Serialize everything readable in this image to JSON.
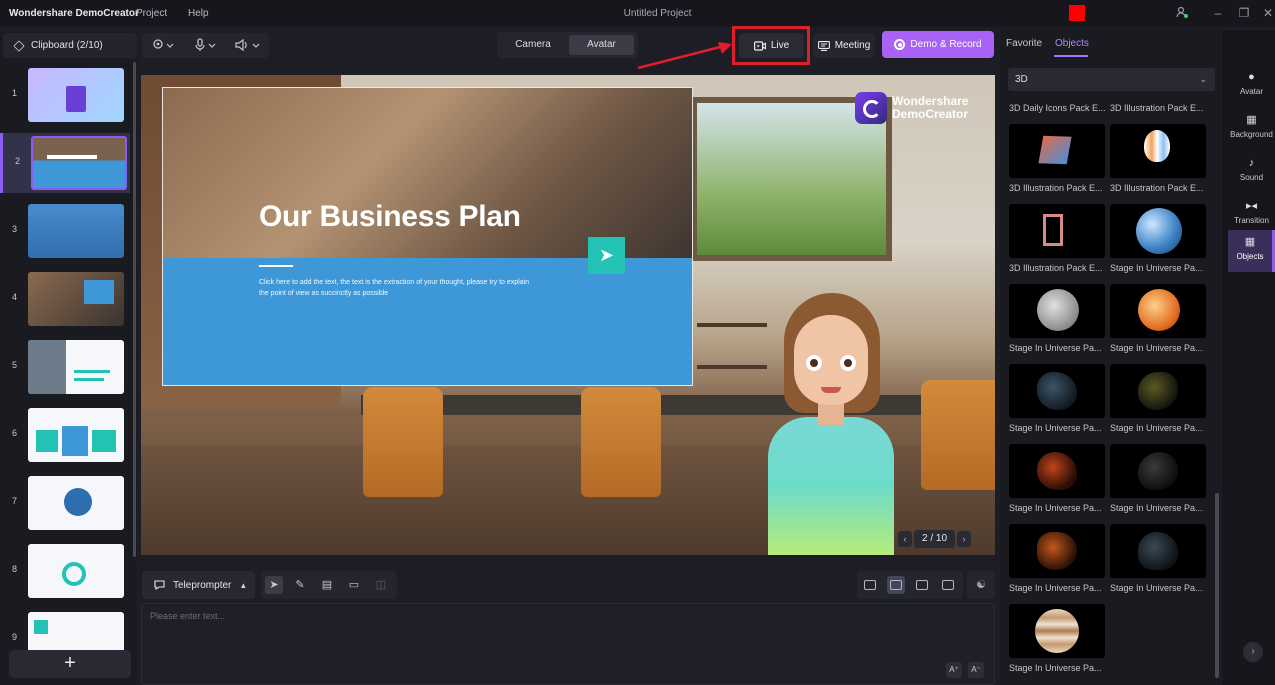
{
  "titlebar": {
    "app_name": "Wondershare DemoCreator",
    "menu": [
      "Project",
      "Help"
    ],
    "project_title": "Untitled Project"
  },
  "clipboard": {
    "title": "Clipboard (2/10)",
    "slides": [
      {
        "num": "1",
        "theme": "purple"
      },
      {
        "num": "2",
        "theme": "business-plan",
        "active": true
      },
      {
        "num": "3",
        "theme": "blue-office"
      },
      {
        "num": "4",
        "theme": "desk"
      },
      {
        "num": "5",
        "theme": "marketing-analysis"
      },
      {
        "num": "6",
        "theme": "marketing-bars"
      },
      {
        "num": "7",
        "theme": "diagram"
      },
      {
        "num": "8",
        "theme": "financial-analysis"
      },
      {
        "num": "9",
        "theme": "swot"
      }
    ],
    "add_label": "+"
  },
  "toolbar": {
    "camera": "Camera",
    "avatar": "Avatar",
    "live": "Live",
    "meeting": "Meeting",
    "demo_record": "Demo & Record"
  },
  "preview": {
    "slide_title": "Our Business Plan",
    "slide_body": "Click here to add the text, the text is the extraction of your thought, please try to explain the point of view as succinctly as possible",
    "logo_line1": "Wondershare",
    "logo_line2": "DemoCreator",
    "page_count": "2 / 10"
  },
  "teleprompter": {
    "label": "Teleprompter",
    "placeholder": "Please enter text..."
  },
  "objects_panel": {
    "tabs": [
      "Favorite",
      "Objects"
    ],
    "active_tab": "Objects",
    "category": "3D",
    "items": [
      {
        "label": "3D Daily Icons Pack E...",
        "kind": "none"
      },
      {
        "label": "3D Illustration Pack E...",
        "kind": "none"
      },
      {
        "label": "3D Illustration Pack E...",
        "kind": "cube"
      },
      {
        "label": "3D Illustration Pack E...",
        "kind": "balloon"
      },
      {
        "label": "3D Illustration Pack E...",
        "kind": "frame"
      },
      {
        "label": "Stage In Universe Pa...",
        "kind": "earth"
      },
      {
        "label": "Stage In Universe Pa...",
        "kind": "moon"
      },
      {
        "label": "Stage In Universe Pa...",
        "kind": "sun"
      },
      {
        "label": "Stage In Universe Pa...",
        "kind": "rock-blue"
      },
      {
        "label": "Stage In Universe Pa...",
        "kind": "rock-yellow"
      },
      {
        "label": "Stage In Universe Pa...",
        "kind": "rock-red"
      },
      {
        "label": "Stage In Universe Pa...",
        "kind": "rock-dark"
      },
      {
        "label": "Stage In Universe Pa...",
        "kind": "rock-orange"
      },
      {
        "label": "Stage In Universe Pa...",
        "kind": "rock-grey"
      },
      {
        "label": "Stage In Universe Pa...",
        "kind": "jupiter"
      }
    ]
  },
  "sidebar": {
    "items": [
      {
        "label": "Avatar",
        "icon": "person-icon"
      },
      {
        "label": "Background",
        "icon": "background-icon"
      },
      {
        "label": "Sound",
        "icon": "music-icon"
      },
      {
        "label": "Transition",
        "icon": "transition-icon"
      },
      {
        "label": "Objects",
        "icon": "objects-icon",
        "active": true
      }
    ]
  },
  "colors": {
    "accent": "#a862f5",
    "highlight_red": "#e01e2b",
    "slide_blue": "#3e98d8"
  }
}
